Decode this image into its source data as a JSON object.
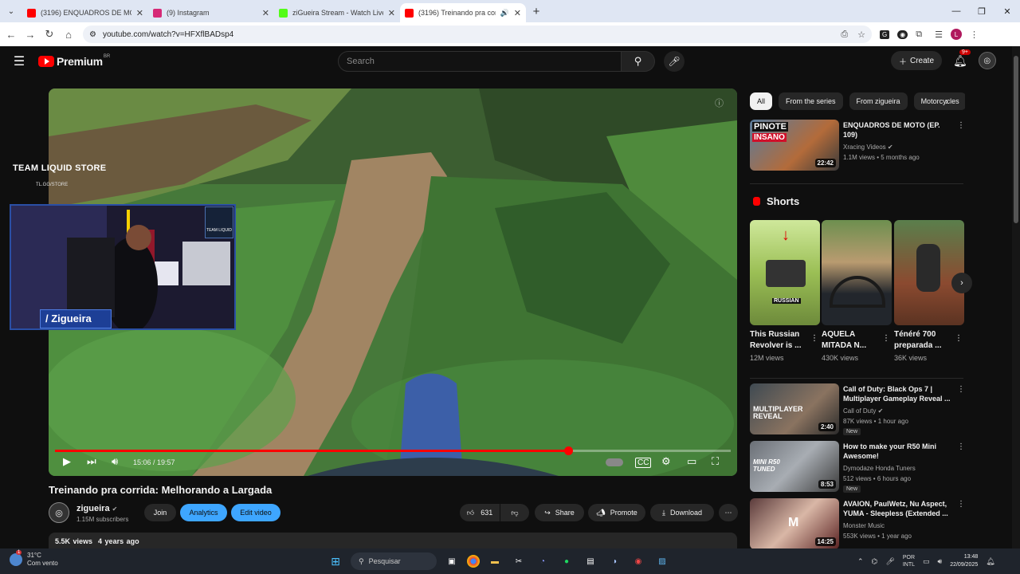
{
  "browser": {
    "tabs": [
      {
        "title": "(3196) ENQUADROS DE MOTO",
        "icon": "youtube-icon",
        "color": "#ff0000",
        "active": false
      },
      {
        "title": "(9) Instagram",
        "icon": "instagram-icon",
        "color": "#d62976",
        "active": false
      },
      {
        "title": "ziGueira Stream - Watch Live on",
        "icon": "kick-icon",
        "color": "#53fc18",
        "active": false
      },
      {
        "title": "(3196) Treinando pra corrid",
        "icon": "youtube-icon",
        "color": "#ff0000",
        "active": true
      }
    ],
    "url": "youtube.com/watch?v=HFXflBADsp4"
  },
  "yt": {
    "logo_text": "Premium",
    "logo_region": "BR",
    "search_placeholder": "Search",
    "create_label": "Create",
    "notif_badge": "9+"
  },
  "player": {
    "overlay_store": "TEAM LIQUID STORE",
    "overlay_store_sub": "TL.GG/STORE",
    "team_logo": "TEAM LIQUID",
    "streamer_tag": "/ Zigueira",
    "time": "15:06 / 19:57",
    "progress": 0.76
  },
  "video": {
    "title": "Treinando pra corrida: Melhorando a Largada",
    "channel": "zigueira",
    "subscribers": "1.15M subscribers",
    "join_label": "Join",
    "analytics_label": "Analytics",
    "edit_label": "Edit video",
    "likes": "631",
    "share_label": "Share",
    "promote_label": "Promote",
    "download_label": "Download",
    "views": "5.5K views",
    "age": "4 years ago"
  },
  "chips": [
    "All",
    "From the series",
    "From zigueira",
    "Motorcycles"
  ],
  "top_video": {
    "title": "ENQUADROS DE MOTO (EP. 109)",
    "channel": "Xracing Videos",
    "meta": "1.1M views • 5 months ago",
    "duration": "22:42",
    "thumb_text_1": "PINOTE",
    "thumb_text_2": "INSANO"
  },
  "shorts": {
    "heading": "Shorts",
    "items": [
      {
        "title": "This Russian Revolver is ...",
        "views": "12M views",
        "thumb_text": "RUSSIAN"
      },
      {
        "title": "AQUELA MITADA N...",
        "views": "430K views",
        "thumb_text": ""
      },
      {
        "title": "Ténéré 700 preparada ...",
        "views": "36K views",
        "thumb_text": ""
      }
    ]
  },
  "rec": [
    {
      "title": "Call of Duty: Black Ops 7 | Multiplayer Gameplay Reveal ...",
      "channel": "Call of Duty",
      "meta": "87K views • 1 hour ago",
      "badge": "New",
      "duration": "2:40",
      "thumb_text": "MULTIPLAYER REVEAL"
    },
    {
      "title": "How to make your R50 Mini Awesome!",
      "channel": "Dymodaze Honda Tuners",
      "meta": "512 views • 6 hours ago",
      "badge": "New",
      "duration": "8:53",
      "thumb_text": "MINI R50 TUNED"
    },
    {
      "title": "AVAION, PaulWetz, Nu Aspect, YUMA - Sleepless (Extended ...",
      "channel": "Monster Music",
      "meta": "553K views • 1 year ago",
      "badge": "",
      "duration": "14:25",
      "thumb_text": "M"
    }
  ],
  "taskbar": {
    "temp": "31°C",
    "weather": "Com vento",
    "weather_badge": "1",
    "search_placeholder": "Pesquisar",
    "lang_1": "POR",
    "lang_2": "INTL",
    "time": "13:48",
    "date": "22/09/2025"
  }
}
